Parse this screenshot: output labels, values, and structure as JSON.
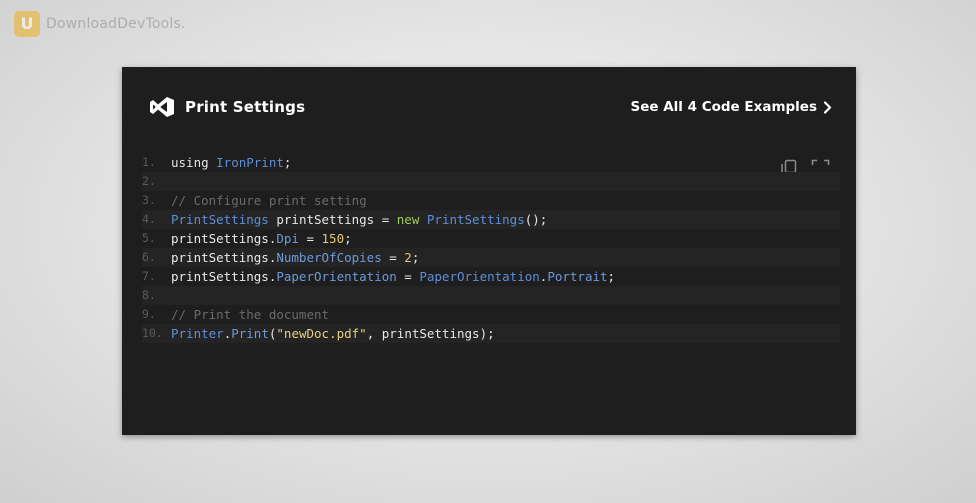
{
  "watermark": {
    "logo_letter": "U",
    "text": "DownloadDevTools."
  },
  "card": {
    "title": "Print Settings",
    "title_icon": "visual-studio-icon",
    "see_all_label": "See All 4 Code Examples",
    "see_all_icon": "chevron-right-icon",
    "tools": [
      {
        "name": "copy-icon"
      },
      {
        "name": "fullscreen-icon"
      }
    ],
    "code_lines": [
      {
        "num": "1.",
        "tokens": [
          {
            "t": "using ",
            "k": "plain"
          },
          {
            "t": "IronPrint",
            "k": "type"
          },
          {
            "t": ";",
            "k": "plain"
          }
        ]
      },
      {
        "num": "2.",
        "tokens": []
      },
      {
        "num": "3.",
        "tokens": [
          {
            "t": "// Configure print setting",
            "k": "comment"
          }
        ]
      },
      {
        "num": "4.",
        "tokens": [
          {
            "t": "PrintSettings",
            "k": "type"
          },
          {
            "t": " printSettings = ",
            "k": "plain"
          },
          {
            "t": "new",
            "k": "keyword"
          },
          {
            "t": " ",
            "k": "plain"
          },
          {
            "t": "PrintSettings",
            "k": "type"
          },
          {
            "t": "();",
            "k": "plain"
          }
        ]
      },
      {
        "num": "5.",
        "tokens": [
          {
            "t": "printSettings.",
            "k": "ident"
          },
          {
            "t": "Dpi",
            "k": "member"
          },
          {
            "t": " = ",
            "k": "plain"
          },
          {
            "t": "150",
            "k": "number"
          },
          {
            "t": ";",
            "k": "plain"
          }
        ]
      },
      {
        "num": "6.",
        "tokens": [
          {
            "t": "printSettings.",
            "k": "ident"
          },
          {
            "t": "NumberOfCopies",
            "k": "member"
          },
          {
            "t": " = ",
            "k": "plain"
          },
          {
            "t": "2",
            "k": "number"
          },
          {
            "t": ";",
            "k": "plain"
          }
        ]
      },
      {
        "num": "7.",
        "tokens": [
          {
            "t": "printSettings.",
            "k": "ident"
          },
          {
            "t": "PaperOrientation",
            "k": "member"
          },
          {
            "t": " = ",
            "k": "plain"
          },
          {
            "t": "PaperOrientation",
            "k": "type"
          },
          {
            "t": ".",
            "k": "plain"
          },
          {
            "t": "Portrait",
            "k": "member"
          },
          {
            "t": ";",
            "k": "plain"
          }
        ]
      },
      {
        "num": "8.",
        "tokens": []
      },
      {
        "num": "9.",
        "tokens": [
          {
            "t": "// Print the document",
            "k": "comment"
          }
        ]
      },
      {
        "num": "10.",
        "tokens": [
          {
            "t": "Printer",
            "k": "type"
          },
          {
            "t": ".",
            "k": "plain"
          },
          {
            "t": "Print",
            "k": "member"
          },
          {
            "t": "(",
            "k": "plain"
          },
          {
            "t": "\"newDoc.pdf\"",
            "k": "string"
          },
          {
            "t": ", printSettings);",
            "k": "plain"
          }
        ]
      }
    ]
  },
  "colors": {
    "card_bg": "#1e1e1f",
    "type": "#5c8fd6",
    "keyword": "#9ccc5a",
    "number": "#e0c872",
    "string": "#e3d17a",
    "comment": "#6a6a6a"
  }
}
